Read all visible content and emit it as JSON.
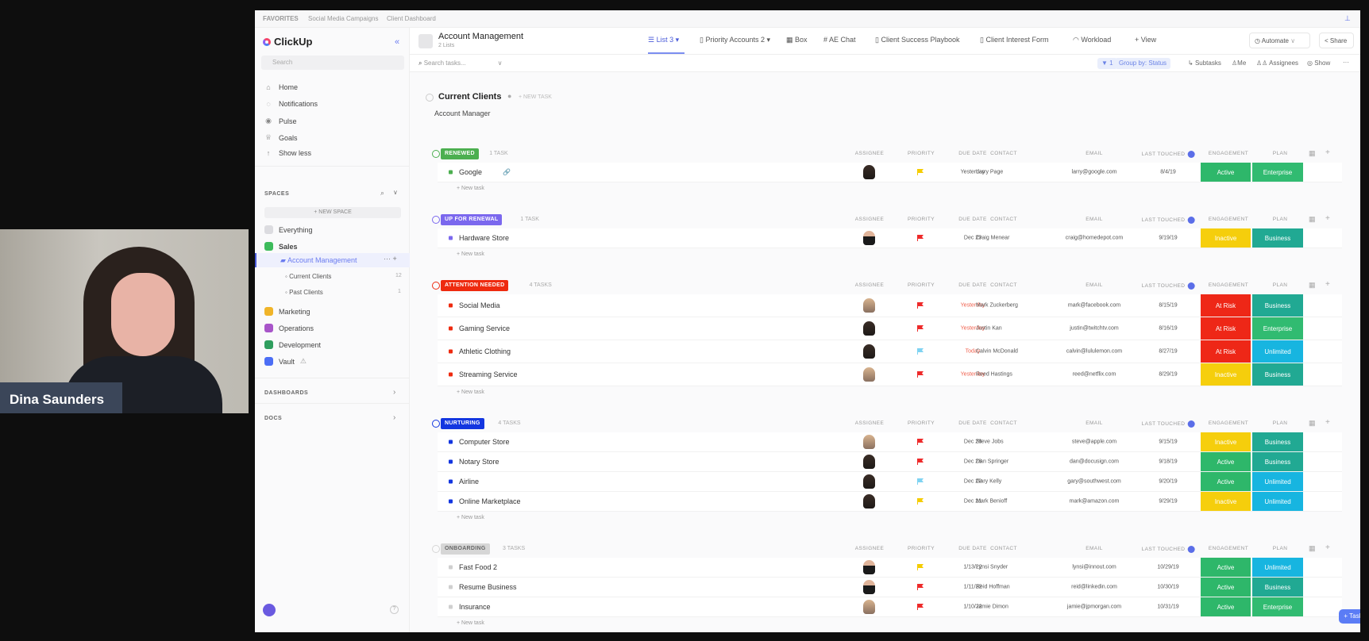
{
  "video": {
    "participant_name": "Dina Saunders"
  },
  "favorites": {
    "label": "FAVORITES",
    "items": [
      "Social Media Campaigns",
      "Client Dashboard"
    ]
  },
  "sidebar": {
    "logo": "ClickUp",
    "search_placeholder": "Search",
    "nav": [
      {
        "label": "Home",
        "icon": "⌂"
      },
      {
        "label": "Notifications",
        "icon": "🔔"
      },
      {
        "label": "Pulse",
        "icon": "◉"
      },
      {
        "label": "Goals",
        "icon": "🏆"
      },
      {
        "label": "Show less",
        "icon": "↑"
      }
    ],
    "spaces_label": "SPACES",
    "new_space": "+ NEW SPACE",
    "spaces": [
      {
        "label": "Everything",
        "color": "#d0d0d4"
      },
      {
        "label": "Sales",
        "color": "#3dbb5b"
      }
    ],
    "folder": "Account Management",
    "lists": [
      {
        "label": "Current Clients",
        "count": "12"
      },
      {
        "label": "Past Clients",
        "count": "1"
      }
    ],
    "spaces2": [
      {
        "label": "Marketing",
        "color": "#f0b429"
      },
      {
        "label": "Operations",
        "color": "#a855c9"
      },
      {
        "label": "Development",
        "color": "#2f9e5e"
      },
      {
        "label": "Vault",
        "color": "#4c6ef5"
      }
    ],
    "dashboards": "DASHBOARDS",
    "docs": "DOCS"
  },
  "header": {
    "title": "Account Management",
    "subtitle": "2 Lists",
    "tabs": [
      {
        "label": "List 3 ▾",
        "icon": "☰"
      },
      {
        "label": "Priority Accounts 2 ▾",
        "icon": "▯"
      },
      {
        "label": "Box",
        "icon": "▦"
      },
      {
        "label": "AE Chat",
        "icon": "#"
      },
      {
        "label": "Client Success Playbook",
        "icon": "▯"
      },
      {
        "label": "Client Interest Form",
        "icon": "▯"
      },
      {
        "label": "Workload",
        "icon": "◠"
      },
      {
        "label": "+ View",
        "icon": ""
      }
    ],
    "automate": "Automate",
    "share": "Share"
  },
  "toolbar": {
    "search_placeholder": "Search tasks...",
    "filter": "▼ 1",
    "group_by": "Group by: Status",
    "subtasks": "Subtasks",
    "me": "Me",
    "assignees": "Assignees",
    "show": "Show",
    "more": "···"
  },
  "list": {
    "title": "Current Clients",
    "new_task": "+ NEW TASK",
    "subheading": "Account Manager"
  },
  "columns": [
    "ASSIGNEE",
    "PRIORITY",
    "DUE DATE",
    "CONTACT",
    "EMAIL",
    "LAST TOUCHED",
    "ENGAGEMENT",
    "PLAN"
  ],
  "new_task_label": "+ New task",
  "fab_label": "+ Task",
  "colors": {
    "Active": "#23b463",
    "At Risk": "#ee1c0b",
    "Inactive": "#f5cc00",
    "Enterprise": "#27b86a",
    "Business": "#16a58e",
    "Unlimited": "#0bb2df",
    "urgent": "#ee2a2a",
    "normal": "#7fd3f2",
    "high": "#f5cc00"
  },
  "groups": [
    {
      "status": "RENEWED",
      "count": "1 TASK",
      "color": "#4caf50",
      "tasks": [
        {
          "name": "Google",
          "assignee": "woman-dark",
          "priority": "high",
          "due": "Yesterday",
          "overdue": false,
          "contact": "Larry Page",
          "email": "larry@google.com",
          "last_touched": "8/4/19",
          "engagement": "Active",
          "plan": "Enterprise"
        }
      ]
    },
    {
      "status": "UP FOR RENEWAL",
      "count": "1 TASK",
      "color": "#7b68ee",
      "tasks": [
        {
          "name": "Hardware Store",
          "assignee": "man",
          "priority": "urgent",
          "due": "Dec 29",
          "overdue": false,
          "contact": "Craig Menear",
          "email": "craig@homedepot.com",
          "last_touched": "9/19/19",
          "engagement": "Inactive",
          "plan": "Business"
        }
      ]
    },
    {
      "status": "ATTENTION NEEDED",
      "count": "4 TASKS",
      "color": "#ee2a0f",
      "tall": true,
      "tasks": [
        {
          "name": "Social Media",
          "assignee": "woman-blonde",
          "priority": "urgent",
          "due": "Yesterday",
          "overdue": true,
          "contact": "Mark Zuckerberg",
          "email": "mark@facebook.com",
          "last_touched": "8/15/19",
          "engagement": "At Risk",
          "plan": "Business"
        },
        {
          "name": "Gaming Service",
          "assignee": "woman-dark",
          "priority": "urgent",
          "due": "Yesterday",
          "overdue": true,
          "contact": "Justin Kan",
          "email": "justin@twitchtv.com",
          "last_touched": "8/16/19",
          "engagement": "At Risk",
          "plan": "Enterprise"
        },
        {
          "name": "Athletic Clothing",
          "assignee": "woman-dark",
          "priority": "normal",
          "due": "Today",
          "overdue": true,
          "contact": "Calvin McDonald",
          "email": "calvin@lululemon.com",
          "last_touched": "8/27/19",
          "engagement": "At Risk",
          "plan": "Unlimited"
        },
        {
          "name": "Streaming Service",
          "assignee": "woman-blonde",
          "priority": "urgent",
          "due": "Yesterday",
          "overdue": true,
          "contact": "Reed Hastings",
          "email": "reed@netflix.com",
          "last_touched": "8/29/19",
          "engagement": "Inactive",
          "plan": "Business"
        }
      ]
    },
    {
      "status": "NURTURING",
      "count": "4 TASKS",
      "color": "#1336e0",
      "tasks": [
        {
          "name": "Computer Store",
          "assignee": "woman-blonde",
          "priority": "urgent",
          "due": "Dec 28",
          "overdue": false,
          "contact": "Steve Jobs",
          "email": "steve@apple.com",
          "last_touched": "9/15/19",
          "engagement": "Inactive",
          "plan": "Business"
        },
        {
          "name": "Notary Store",
          "assignee": "woman-dark",
          "priority": "urgent",
          "due": "Dec 28",
          "overdue": false,
          "contact": "Dan Springer",
          "email": "dan@docusign.com",
          "last_touched": "9/18/19",
          "engagement": "Active",
          "plan": "Business"
        },
        {
          "name": "Airline",
          "assignee": "woman-dark",
          "priority": "normal",
          "due": "Dec 29",
          "overdue": false,
          "contact": "Gary Kelly",
          "email": "gary@southwest.com",
          "last_touched": "9/20/19",
          "engagement": "Active",
          "plan": "Unlimited"
        },
        {
          "name": "Online Marketplace",
          "assignee": "woman-dark",
          "priority": "high",
          "due": "Dec 21",
          "overdue": false,
          "contact": "Mark Benioff",
          "email": "mark@amazon.com",
          "last_touched": "9/29/19",
          "engagement": "Inactive",
          "plan": "Unlimited"
        }
      ]
    },
    {
      "status": "ONBOARDING",
      "count": "3 TASKS",
      "color": "#d6d6d6",
      "dark_text": true,
      "tasks": [
        {
          "name": "Fast Food 2",
          "assignee": "man",
          "priority": "high",
          "due": "1/13/22",
          "overdue": false,
          "contact": "Lynsi Snyder",
          "email": "lynsi@innout.com",
          "last_touched": "10/29/19",
          "engagement": "Active",
          "plan": "Unlimited"
        },
        {
          "name": "Resume Business",
          "assignee": "man",
          "priority": "urgent",
          "due": "1/11/22",
          "overdue": false,
          "contact": "Reid Hoffman",
          "email": "reid@linkedin.com",
          "last_touched": "10/30/19",
          "engagement": "Active",
          "plan": "Business"
        },
        {
          "name": "Insurance",
          "assignee": "woman-blonde",
          "priority": "urgent",
          "due": "1/10/22",
          "overdue": false,
          "contact": "Jamie Dimon",
          "email": "jamie@jpmorgan.com",
          "last_touched": "10/31/19",
          "engagement": "Active",
          "plan": "Enterprise"
        }
      ]
    }
  ]
}
